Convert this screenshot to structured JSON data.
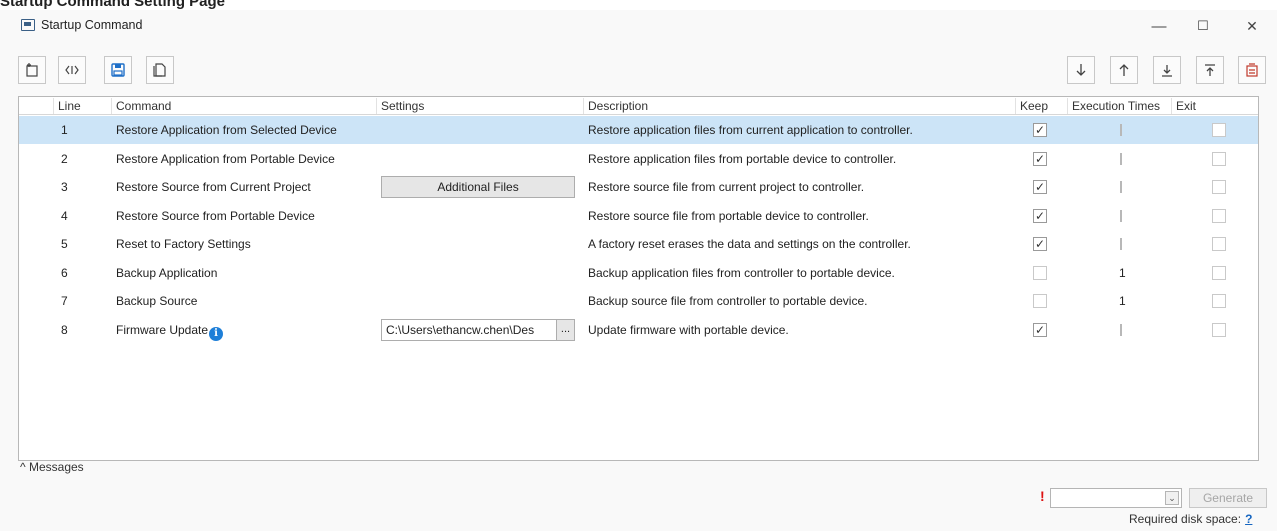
{
  "page_heading": "Startup Command Setting Page",
  "window": {
    "title": "Startup Command",
    "controls": {
      "minimize": "—",
      "maximize": "☐",
      "close": "✕"
    }
  },
  "toolbar": {
    "left_icons": [
      "new-icon",
      "insert-icon",
      "save-icon",
      "copy-icon"
    ],
    "right_icons": [
      "move-down-icon",
      "move-up-icon",
      "move-to-bottom-icon",
      "move-to-top-icon",
      "clear-icon"
    ]
  },
  "table": {
    "columns": {
      "line": "Line",
      "command": "Command",
      "settings": "Settings",
      "description": "Description",
      "keep": "Keep",
      "execution_times": "Execution Times",
      "exit": "Exit"
    },
    "rows": [
      {
        "line": "1",
        "command": "Restore Application from Selected Device",
        "settings": "",
        "description": "Restore application files from current application to controller.",
        "keep": true,
        "exec": "",
        "exit": false,
        "selected": true
      },
      {
        "line": "2",
        "command": "Restore Application from Portable Device",
        "settings": "",
        "description": "Restore application files from portable device to controller.",
        "keep": true,
        "exec": "",
        "exit": false,
        "selected": false
      },
      {
        "line": "3",
        "command": "Restore Source from Current Project",
        "settings": "Additional Files",
        "description": "Restore source file from current project to controller.",
        "keep": true,
        "exec": "",
        "exit": false,
        "selected": false
      },
      {
        "line": "4",
        "command": "Restore Source from Portable Device",
        "settings": "",
        "description": "Restore source file from portable device to controller.",
        "keep": true,
        "exec": "",
        "exit": false,
        "selected": false
      },
      {
        "line": "5",
        "command": "Reset to Factory Settings",
        "settings": "",
        "description": "A factory reset erases the data and settings on the controller.",
        "keep": true,
        "exec": "",
        "exit": false,
        "selected": false
      },
      {
        "line": "6",
        "command": "Backup Application",
        "settings": "",
        "description": "Backup application files from controller to portable device.",
        "keep": false,
        "exec": "1",
        "exit": false,
        "selected": false
      },
      {
        "line": "7",
        "command": "Backup Source",
        "settings": "",
        "description": "Backup source file from controller to portable device.",
        "keep": false,
        "exec": "1",
        "exit": false,
        "selected": false
      },
      {
        "line": "8",
        "command": "Firmware Update",
        "settings": "C:\\Users\\ethancw.chen\\Des",
        "description": "Update firmware with portable device.",
        "keep": true,
        "exec": "",
        "exit": false,
        "selected": false
      }
    ],
    "settings_browse": "..."
  },
  "messages": {
    "toggle": "^",
    "label": "Messages"
  },
  "footer": {
    "warning": "!",
    "combo_value": "",
    "generate": "Generate",
    "disk_space_label": "Required disk space:",
    "disk_space_value": "?"
  },
  "colors": {
    "selected_row": "#cce4f7",
    "info": "#1e7fd8",
    "warning": "#dd1111"
  }
}
